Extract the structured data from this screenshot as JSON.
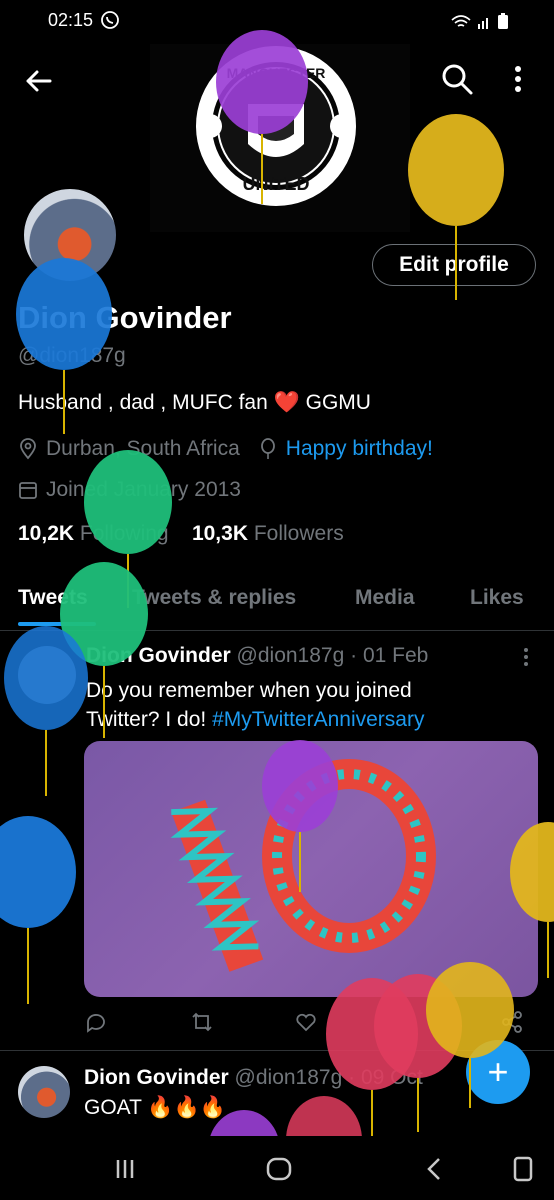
{
  "status_bar": {
    "time": "02:15",
    "icons": [
      "whatsapp-icon",
      "wifi-icon",
      "signal-icon",
      "battery-icon"
    ]
  },
  "header": {
    "back_icon": "arrow-left-icon",
    "search_icon": "search-icon",
    "more_icon": "more-vertical-icon",
    "banner_text_top": "MANCHESTER",
    "banner_text_bottom": "UNITED"
  },
  "profile": {
    "edit_label": "Edit profile",
    "name": "Dion Govinder",
    "handle": "@dion187g",
    "bio": "Husband , dad ,  MUFC  fan",
    "bio_emoji": "❤️",
    "bio_suffix": " GGMU",
    "location": "Durban, South Africa",
    "birthday": "Happy birthday!",
    "joined": "Joined January 2013",
    "following_count": "10,2K",
    "following_label": "Following",
    "followers_count": "10,3K",
    "followers_label": "Followers"
  },
  "tabs": [
    {
      "label": "Tweets",
      "active": true
    },
    {
      "label": "Tweets & replies",
      "active": false
    },
    {
      "label": "Media",
      "active": false
    },
    {
      "label": "Likes",
      "active": false
    }
  ],
  "tweets": [
    {
      "author": "Dion Govinder",
      "handle": "@dion187g",
      "date": "· 01 Feb",
      "text_1": "Do you remember when you joined",
      "text_2": "Twitter? I do! ",
      "hashtag": "#MyTwitterAnniversary"
    },
    {
      "author": "Dion Govinder",
      "handle": "@dion187g",
      "date": "· 09 Oct",
      "text": "GOAT 🔥🔥🔥"
    }
  ],
  "fab_label": "+",
  "colors": {
    "accent": "#1d9bf0",
    "background": "#000000",
    "muted": "#71767b"
  }
}
